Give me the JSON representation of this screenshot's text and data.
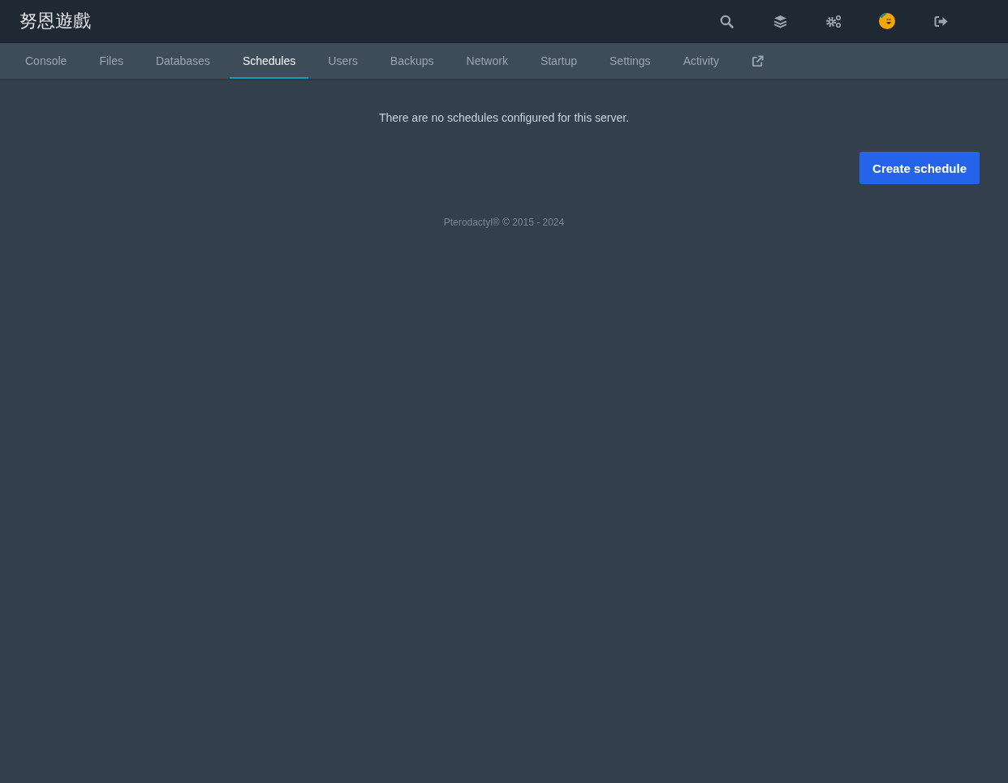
{
  "header": {
    "title": "努恩遊戲"
  },
  "tabs": [
    {
      "label": "Console",
      "selected": false
    },
    {
      "label": "Files",
      "selected": false
    },
    {
      "label": "Databases",
      "selected": false
    },
    {
      "label": "Schedules",
      "selected": true
    },
    {
      "label": "Users",
      "selected": false
    },
    {
      "label": "Backups",
      "selected": false
    },
    {
      "label": "Network",
      "selected": false
    },
    {
      "label": "Startup",
      "selected": false
    },
    {
      "label": "Settings",
      "selected": false
    },
    {
      "label": "Activity",
      "selected": false
    }
  ],
  "empty_message": "There are no schedules configured for this server.",
  "create_button": "Create schedule",
  "footer": "Pterodactyl® © 2015 - 2024"
}
